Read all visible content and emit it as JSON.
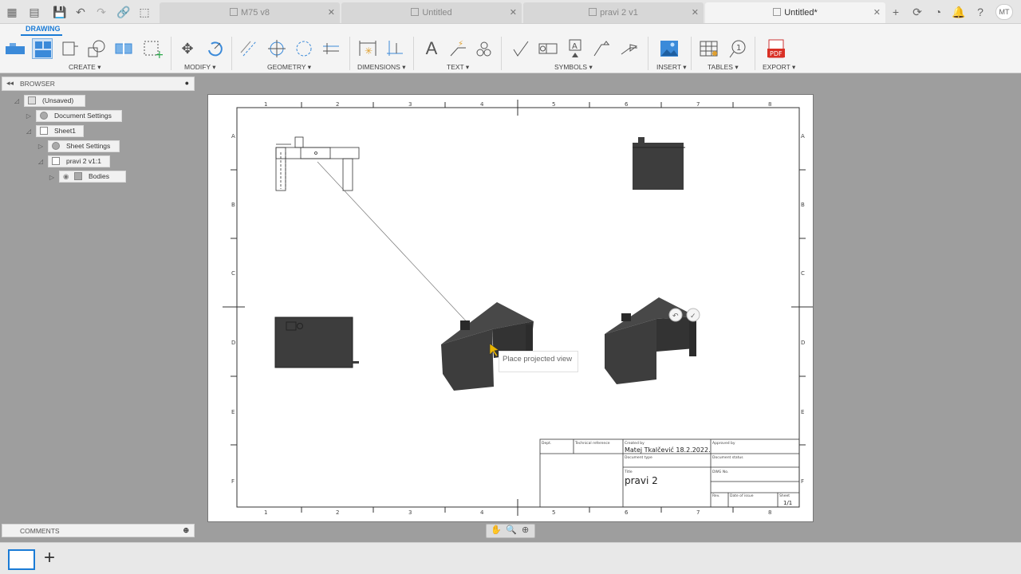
{
  "tabs": [
    {
      "label": "M75 v8",
      "active": false
    },
    {
      "label": "Untitled",
      "active": false
    },
    {
      "label": "pravi 2 v1",
      "active": false
    },
    {
      "label": "Untitled*",
      "active": true
    }
  ],
  "user_initials": "MT",
  "toolbar": {
    "workspace": "DRAWING",
    "groups": {
      "create": "CREATE ▾",
      "modify": "MODIFY ▾",
      "geometry": "GEOMETRY ▾",
      "dimensions": "DIMENSIONS ▾",
      "text": "TEXT ▾",
      "symbols": "SYMBOLS ▾",
      "insert": "INSERT ▾",
      "tables": "TABLES ▾",
      "export": "EXPORT ▾"
    },
    "text_tool": "A",
    "pdf_label": "PDF"
  },
  "browser": {
    "title": "BROWSER",
    "items": [
      {
        "label": "(Unsaved)"
      },
      {
        "label": "Document Settings"
      },
      {
        "label": "Sheet1"
      },
      {
        "label": "Sheet Settings"
      },
      {
        "label": "pravi 2 v1:1"
      },
      {
        "label": "Bodies"
      }
    ]
  },
  "comments": {
    "title": "COMMENTS"
  },
  "drawing": {
    "columns_top": [
      "1",
      "2",
      "3",
      "4",
      "5",
      "6",
      "7",
      "8"
    ],
    "rows_left": [
      "A",
      "B",
      "C",
      "D",
      "E",
      "F"
    ],
    "tooltip": "Place projected view",
    "title_block": {
      "dept_label": "Dept.",
      "tech_ref_label": "Technical reference",
      "created_by_label": "Created by",
      "created_by": "Matej Tkalčević 18.2.2022.",
      "approved_by_label": "Approved by",
      "document_type_label": "Document type",
      "document_status_label": "Document status",
      "title_label": "Title",
      "title": "pravi 2",
      "dwg_no_label": "DWG No.",
      "rev_label": "Rev.",
      "date_of_issue_label": "Date of issue",
      "sheet_label": "Sheet",
      "sheet_value": "1/1"
    }
  },
  "colors": {
    "accent": "#1a7bd6",
    "model": "#3d3d3d"
  }
}
